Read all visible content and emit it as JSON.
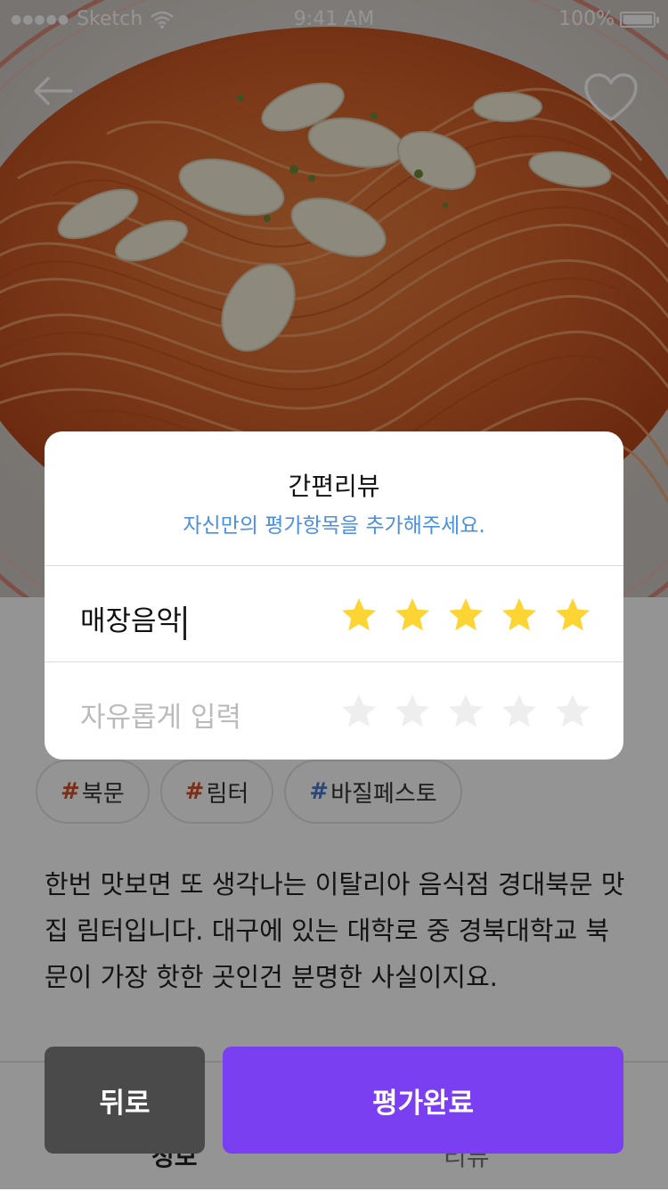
{
  "status_bar": {
    "carrier": "Sketch",
    "time": "9:41 AM",
    "battery": "100%"
  },
  "header": {
    "back_icon": "arrow-left-icon",
    "favorite_icon": "heart-outline-icon"
  },
  "tags": [
    {
      "hash": "#",
      "label": "북문",
      "hash_color": "#d0502b"
    },
    {
      "hash": "#",
      "label": "림터",
      "hash_color": "#d0502b"
    },
    {
      "hash": "#",
      "label": "바질페스토",
      "hash_color": "#4a7bc8"
    }
  ],
  "description": "한번 맛보면 또 생각나는 이탈리아 음식점 경대북문 맛집 림터입니다. 대구에 있는 대학로 중 경북대학교 북문이 가장 핫한 곳인건 분명한 사실이지요.",
  "bottom_tabs": [
    "정보",
    "리뷰"
  ],
  "modal": {
    "title": "간편리뷰",
    "subtitle": "자신만의 평가항목을 추가해주세요.",
    "rows": [
      {
        "label": "매장음악",
        "rating": 5,
        "max": 5
      },
      {
        "placeholder": "자유롭게 입력",
        "rating": 0,
        "max": 5
      }
    ]
  },
  "buttons": {
    "back": "뒤로",
    "complete": "평가완료"
  },
  "colors": {
    "accent": "#7b3ff2",
    "star_filled": "#fcd535",
    "star_empty": "#eeeeee",
    "subtitle": "#4a90e2",
    "back_button": "#4a4a4a"
  }
}
